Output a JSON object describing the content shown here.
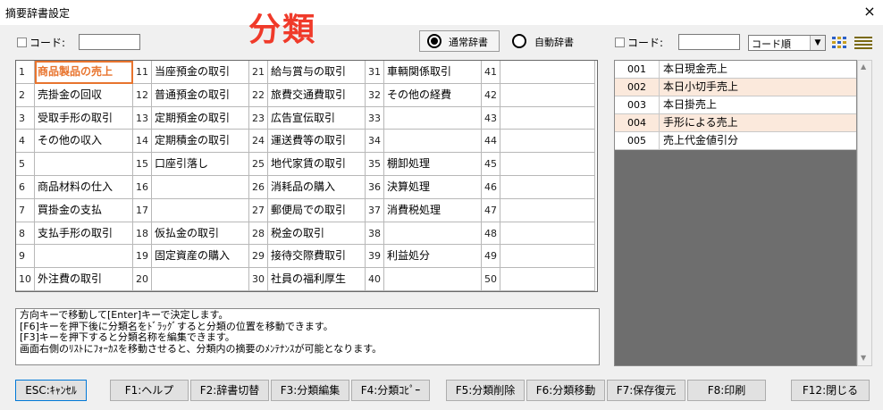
{
  "window": {
    "title": "摘要辞書設定",
    "close_glyph": "×"
  },
  "left_filter": {
    "code_label": "コード:",
    "code_value": ""
  },
  "heading": "分類",
  "dict_mode": {
    "options": [
      "通常辞書",
      "自動辞書"
    ],
    "selected": "通常辞書"
  },
  "right_filter": {
    "code_label": "コード:",
    "code_value": "",
    "sort_selected": "コード順"
  },
  "categories": [
    {
      "no": "1",
      "name": "商品製品の売上"
    },
    {
      "no": "2",
      "name": "売掛金の回収"
    },
    {
      "no": "3",
      "name": "受取手形の取引"
    },
    {
      "no": "4",
      "name": "その他の収入"
    },
    {
      "no": "5",
      "name": ""
    },
    {
      "no": "6",
      "name": "商品材料の仕入"
    },
    {
      "no": "7",
      "name": "買掛金の支払"
    },
    {
      "no": "8",
      "name": "支払手形の取引"
    },
    {
      "no": "9",
      "name": ""
    },
    {
      "no": "10",
      "name": "外注費の取引"
    },
    {
      "no": "11",
      "name": "当座預金の取引"
    },
    {
      "no": "12",
      "name": "普通預金の取引"
    },
    {
      "no": "13",
      "name": "定期預金の取引"
    },
    {
      "no": "14",
      "name": "定期積金の取引"
    },
    {
      "no": "15",
      "name": "口座引落し"
    },
    {
      "no": "16",
      "name": ""
    },
    {
      "no": "17",
      "name": ""
    },
    {
      "no": "18",
      "name": "仮払金の取引"
    },
    {
      "no": "19",
      "name": "固定資産の購入"
    },
    {
      "no": "20",
      "name": ""
    },
    {
      "no": "21",
      "name": "給与賞与の取引"
    },
    {
      "no": "22",
      "name": "旅費交通費取引"
    },
    {
      "no": "23",
      "name": "広告宣伝取引"
    },
    {
      "no": "24",
      "name": "運送費等の取引"
    },
    {
      "no": "25",
      "name": "地代家賃の取引"
    },
    {
      "no": "26",
      "name": "消耗品の購入"
    },
    {
      "no": "27",
      "name": "郵便局での取引"
    },
    {
      "no": "28",
      "name": "税金の取引"
    },
    {
      "no": "29",
      "name": "接待交際費取引"
    },
    {
      "no": "30",
      "name": "社員の福利厚生"
    },
    {
      "no": "31",
      "name": "車輌関係取引"
    },
    {
      "no": "32",
      "name": "その他の経費"
    },
    {
      "no": "33",
      "name": ""
    },
    {
      "no": "34",
      "name": ""
    },
    {
      "no": "35",
      "name": "棚卸処理"
    },
    {
      "no": "36",
      "name": "決算処理"
    },
    {
      "no": "37",
      "name": "消費税処理"
    },
    {
      "no": "38",
      "name": ""
    },
    {
      "no": "39",
      "name": "利益処分"
    },
    {
      "no": "40",
      "name": ""
    },
    {
      "no": "41",
      "name": ""
    },
    {
      "no": "42",
      "name": ""
    },
    {
      "no": "43",
      "name": ""
    },
    {
      "no": "44",
      "name": ""
    },
    {
      "no": "45",
      "name": ""
    },
    {
      "no": "46",
      "name": ""
    },
    {
      "no": "47",
      "name": ""
    },
    {
      "no": "48",
      "name": ""
    },
    {
      "no": "49",
      "name": ""
    },
    {
      "no": "50",
      "name": ""
    }
  ],
  "selected_category": "1",
  "summaries": [
    {
      "code": "001",
      "text": "本日現金売上"
    },
    {
      "code": "002",
      "text": "本日小切手売上"
    },
    {
      "code": "003",
      "text": "本日掛売上"
    },
    {
      "code": "004",
      "text": "手形による売上"
    },
    {
      "code": "005",
      "text": "売上代金値引分"
    }
  ],
  "message_lines": [
    "方向キーで移動して[Enter]キーで決定します。",
    "[F6]キーを押下後に分類名をﾄﾞﾗｯｸﾞすると分類の位置を移動できます。",
    "[F3]キーを押下すると分類名称を編集できます。",
    "画面右側のﾘｽﾄにﾌｫｰｶｽを移動させると、分類内の摘要のﾒﾝﾃﾅﾝｽが可能となります。"
  ],
  "buttons": {
    "esc": "ESC:ｷｬﾝｾﾙ",
    "f1": "F1:ヘルプ",
    "f2": "F2:辞書切替",
    "f3": "F3:分類編集",
    "f4": "F4:分類ｺﾋﾟｰ",
    "f5": "F5:分類削除",
    "f6": "F6:分類移動",
    "f7": "F7:保存復元",
    "f8": "F8:印刷",
    "f12": "F12:閉じる"
  },
  "colors": {
    "accent": "#f03a2a",
    "selection": "#e8742e",
    "alt_row": "#fbe9dc",
    "list_bg": "#6e6e6e"
  },
  "icons": {
    "view_grid": "grid-view-icon",
    "view_list": "list-view-icon",
    "scroll_up": "▲",
    "scroll_down": "▼"
  }
}
